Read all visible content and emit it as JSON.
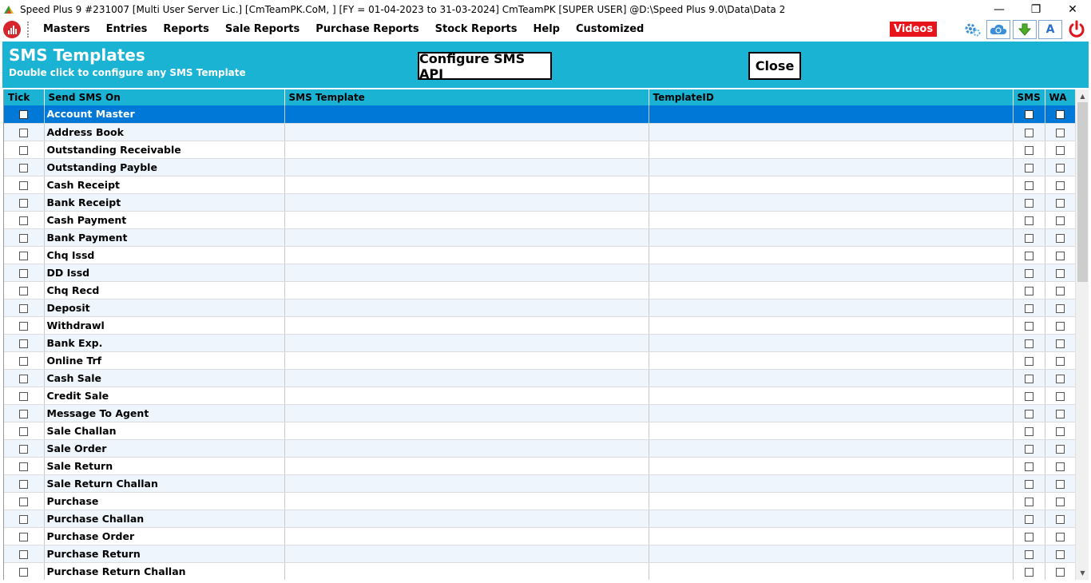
{
  "window": {
    "title": "Speed Plus 9 #231007  [Multi User Server Lic.]  [CmTeamPK.CoM, ] [FY = 01-04-2023 to 31-03-2024] CmTeamPK [SUPER USER]  @D:\\Speed Plus 9.0\\Data\\Data 2",
    "minimize": "—",
    "restore": "❐",
    "close": "✕"
  },
  "menu": {
    "items": [
      "Masters",
      "Entries",
      "Reports",
      "Sale Reports",
      "Purchase Reports",
      "Stock Reports",
      "Help",
      "Customized"
    ],
    "videos_label": "Videos",
    "icons": [
      "gear-icon",
      "cloud-sync-icon",
      "download-arrow-icon",
      "font-a-icon",
      "power-icon"
    ],
    "icon_a_text": "A"
  },
  "header": {
    "title": "SMS Templates",
    "subtitle": "Double click to configure any SMS Template",
    "configure_button": "Configure SMS API",
    "close_button": "Close",
    "color": "#1bb3d4"
  },
  "grid": {
    "columns": [
      "Tick",
      "Send SMS On",
      "SMS Template",
      "TemplateID",
      "SMS",
      "WA"
    ],
    "selected_row": 0,
    "selection_color": "#0078d7",
    "rows": [
      "Account Master",
      "Address Book",
      "Outstanding Receivable",
      "Outstanding Payble",
      "Cash Receipt",
      "Bank Receipt",
      "Cash Payment",
      "Bank Payment",
      "Chq Issd",
      "DD Issd",
      "Chq Recd",
      "Deposit",
      "Withdrawl",
      "Bank Exp.",
      "Online Trf",
      "Cash Sale",
      "Credit Sale",
      "Message To Agent",
      "Sale Challan",
      "Sale Order",
      "Sale Return",
      "Sale Return Challan",
      "Purchase",
      "Purchase Challan",
      "Purchase Order",
      "Purchase Return",
      "Purchase Return Challan"
    ]
  }
}
